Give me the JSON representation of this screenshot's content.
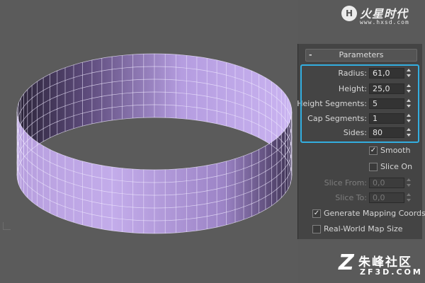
{
  "watermarks": {
    "top_logo_text": "火星时代",
    "top_logo_url": "www.hxsd.com",
    "bottom_logo_text": "朱峰社区",
    "bottom_logo_url": "ZF3D.COM"
  },
  "viewport": {
    "object": "tube",
    "wire_color": "#b79fde",
    "highlight_color": "#33aee0"
  },
  "panel": {
    "rollout_title": "Parameters",
    "params": [
      {
        "label": "Radius:",
        "value": "61,0",
        "enabled": true
      },
      {
        "label": "Height:",
        "value": "25,0",
        "enabled": true
      },
      {
        "label": "Height Segments:",
        "value": "5",
        "enabled": true
      },
      {
        "label": "Cap Segments:",
        "value": "1",
        "enabled": true
      },
      {
        "label": "Sides:",
        "value": "80",
        "enabled": true
      }
    ],
    "smooth": {
      "label": "Smooth",
      "checked": true
    },
    "slice_on": {
      "label": "Slice On",
      "checked": false
    },
    "slice_from": {
      "label": "Slice From:",
      "value": "0,0",
      "enabled": false
    },
    "slice_to": {
      "label": "Slice To:",
      "value": "0,0",
      "enabled": false
    },
    "gen_mapping": {
      "label": "Generate Mapping Coords.",
      "checked": true
    },
    "real_world": {
      "label": "Real-World Map Size",
      "checked": false
    }
  }
}
